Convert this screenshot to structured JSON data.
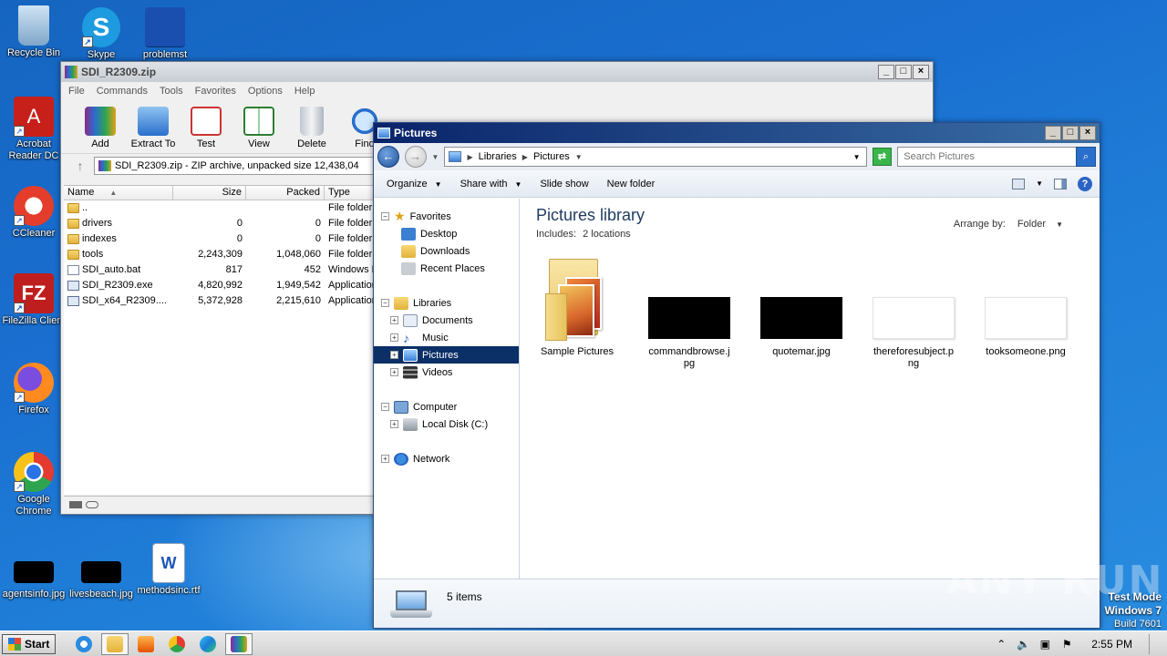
{
  "desktop": {
    "icons": [
      {
        "label": "Recycle Bin"
      },
      {
        "label": "Skype"
      },
      {
        "label": "problemst"
      },
      {
        "label": "Acrobat Reader DC"
      },
      {
        "label": "CCleaner"
      },
      {
        "label": "FileZilla Client"
      },
      {
        "label": "Firefox"
      },
      {
        "label": "Google Chrome"
      },
      {
        "label": "agentsinfo.jpg"
      },
      {
        "label": "livesbeach.jpg"
      },
      {
        "label": "methodsinc.rtf"
      }
    ]
  },
  "winrar": {
    "title": "SDI_R2309.zip",
    "menu": [
      "File",
      "Commands",
      "Tools",
      "Favorites",
      "Options",
      "Help"
    ],
    "toolbar": [
      "Add",
      "Extract To",
      "Test",
      "View",
      "Delete",
      "Find"
    ],
    "address": "SDI_R2309.zip - ZIP archive, unpacked size 12,438,04",
    "columns": [
      "Name",
      "Size",
      "Packed",
      "Type"
    ],
    "rows": [
      {
        "name": "..",
        "size": "",
        "packed": "",
        "type": "File folder",
        "icon": "folder"
      },
      {
        "name": "drivers",
        "size": "0",
        "packed": "0",
        "type": "File folder",
        "icon": "folder"
      },
      {
        "name": "indexes",
        "size": "0",
        "packed": "0",
        "type": "File folder",
        "icon": "folder"
      },
      {
        "name": "tools",
        "size": "2,243,309",
        "packed": "1,048,060",
        "type": "File folder",
        "icon": "folder"
      },
      {
        "name": "SDI_auto.bat",
        "size": "817",
        "packed": "452",
        "type": "Windows E",
        "icon": "file"
      },
      {
        "name": "SDI_R2309.exe",
        "size": "4,820,992",
        "packed": "1,949,542",
        "type": "Application",
        "icon": "exe"
      },
      {
        "name": "SDI_x64_R2309....",
        "size": "5,372,928",
        "packed": "2,215,610",
        "type": "Application",
        "icon": "exe"
      }
    ]
  },
  "explorer": {
    "title": "Pictures",
    "breadcrumb": [
      "Libraries",
      "Pictures"
    ],
    "search_placeholder": "Search Pictures",
    "commands": {
      "organize": "Organize",
      "share": "Share with",
      "slideshow": "Slide show",
      "newfolder": "New folder"
    },
    "nav": {
      "favorites": "Favorites",
      "fav_items": [
        "Desktop",
        "Downloads",
        "Recent Places"
      ],
      "libraries": "Libraries",
      "lib_items": [
        "Documents",
        "Music",
        "Pictures",
        "Videos"
      ],
      "computer": "Computer",
      "computer_items": [
        "Local Disk (C:)"
      ],
      "network": "Network"
    },
    "library_title": "Pictures library",
    "includes_label": "Includes:",
    "includes_value": "2 locations",
    "arrange_label": "Arrange by:",
    "arrange_value": "Folder",
    "items": [
      {
        "name": "Sample Pictures",
        "kind": "folder"
      },
      {
        "name": "commandbrowse.jpg",
        "kind": "black"
      },
      {
        "name": "quotemar.jpg",
        "kind": "black"
      },
      {
        "name": "thereforesubject.png",
        "kind": "white"
      },
      {
        "name": "tooksomeone.png",
        "kind": "white"
      }
    ],
    "status": "5 items"
  },
  "taskbar": {
    "start": "Start",
    "clock": "2:55 PM"
  },
  "watermark": "ANY RUN",
  "testmode": {
    "line1": "Test Mode",
    "line2": "Windows 7",
    "line3": "Build 7601"
  }
}
